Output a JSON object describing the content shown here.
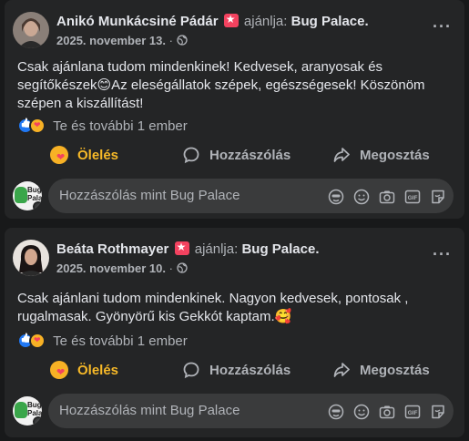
{
  "posts": [
    {
      "author": "Anikó Munkácsiné Pádár",
      "verb": "ajánlja:",
      "page": "Bug Palace.",
      "date": "2025. november 13.",
      "separator": "·",
      "text": "Csak ajánlana tudom mindenkinek! Kedvesek, aranyosak és segítőkészek😊Az eleségállatok szépek, egészségesek! Köszönöm szépen a kiszállítást!",
      "reactions_text": "Te és további 1 ember",
      "actions": {
        "hug": "Ölelés",
        "comment": "Hozzászólás",
        "share": "Megosztás"
      },
      "comment_placeholder": "Hozzászólás mint Bug Palace",
      "commenter_avatar_text": "Bug Palace"
    },
    {
      "author": "Beáta Rothmayer",
      "verb": "ajánlja:",
      "page": "Bug Palace.",
      "date": "2025. november 10.",
      "separator": "·",
      "text": "Csak ajánlani tudom mindenkinek. Nagyon kedvesek, pontosak , rugalmasak. Gyönyörű kis Gekkót kaptam.🥰",
      "reactions_text": "Te és további 1 ember",
      "actions": {
        "hug": "Ölelés",
        "comment": "Hozzászólás",
        "share": "Megosztás"
      },
      "comment_placeholder": "Hozzászólás mint Bug Palace",
      "commenter_avatar_text": "Bug Palace"
    }
  ],
  "colors": {
    "background": "#18191a",
    "card": "#242526",
    "input": "#3a3b3c",
    "text_primary": "#e4e6eb",
    "text_secondary": "#b0b3b8",
    "hug_accent": "#f7b928",
    "like_blue": "#2078f4",
    "recommend_red": "#f3425f"
  },
  "icons": {
    "more": "more-options-icon",
    "globe": "globe-public-icon",
    "recommend": "recommend-badge-icon",
    "like": "like-reaction-icon",
    "care": "care-reaction-icon",
    "comment": "comment-bubble-icon",
    "share": "share-arrow-icon",
    "sticker": "avatar-sticker-icon",
    "emoji": "emoji-icon",
    "camera": "camera-icon",
    "gif": "gif-icon",
    "sticker2": "sticker-icon"
  }
}
